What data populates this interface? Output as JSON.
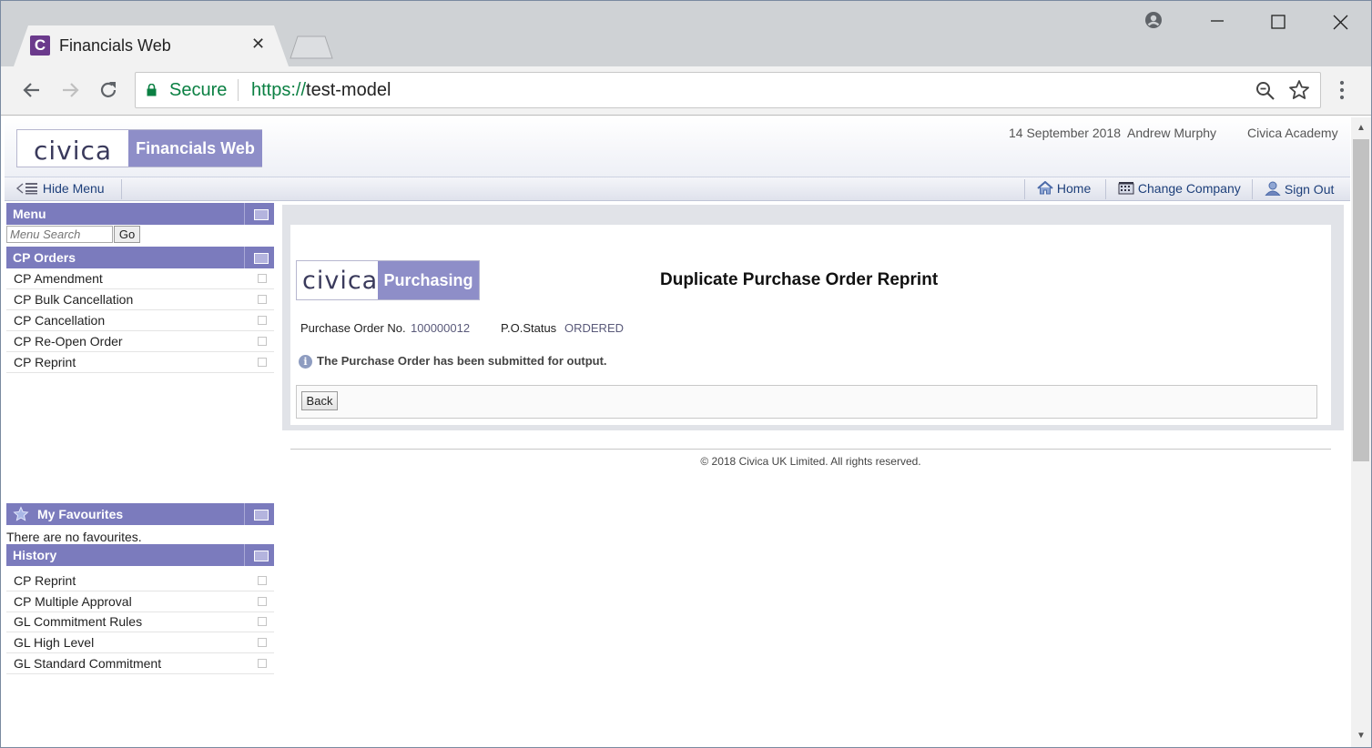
{
  "browser": {
    "tab_title": "Financials Web",
    "tab_favicon": "C",
    "close_tab": "✕",
    "secure_label": "Secure",
    "url_scheme": "https://",
    "url_host": "test-model"
  },
  "header": {
    "logo_civica": "civica",
    "logo_app": "Financials Web",
    "date": "14 September 2018",
    "user": "Andrew Murphy",
    "company": "Civica Academy"
  },
  "menubar": {
    "hide_menu": "Hide Menu",
    "home": "Home",
    "change_company": "Change Company",
    "sign_out": "Sign Out"
  },
  "sidebar": {
    "menu_title": "Menu",
    "search_placeholder": "Menu Search",
    "go_label": "Go",
    "orders_title": "CP Orders",
    "orders_items": [
      "CP Amendment",
      "CP Bulk Cancellation",
      "CP Cancellation",
      "CP Re-Open Order",
      "CP Reprint"
    ],
    "favourites_title": "My Favourites",
    "favourites_empty": "There are no favourites.",
    "history_title": "History",
    "history_items": [
      "CP Reprint",
      "CP Multiple Approval",
      "GL Commitment Rules",
      "GL High Level",
      "GL Standard Commitment"
    ]
  },
  "content": {
    "logo_civica": "civica",
    "logo_app": "Purchasing",
    "title": "Duplicate Purchase Order Reprint",
    "po_no_label": "Purchase Order No.",
    "po_no_value": "100000012",
    "po_status_label": "P.O.Status",
    "po_status_value": "ORDERED",
    "info_message": "The Purchase Order has been submitted for output.",
    "back_label": "Back",
    "footer": "© 2018 Civica UK Limited. All rights reserved."
  },
  "colors": {
    "brand_purple": "#8e8ec8",
    "panel_header": "#7b7bbd",
    "link_blue": "#1d3f7a",
    "secure_green": "#0b8043"
  }
}
